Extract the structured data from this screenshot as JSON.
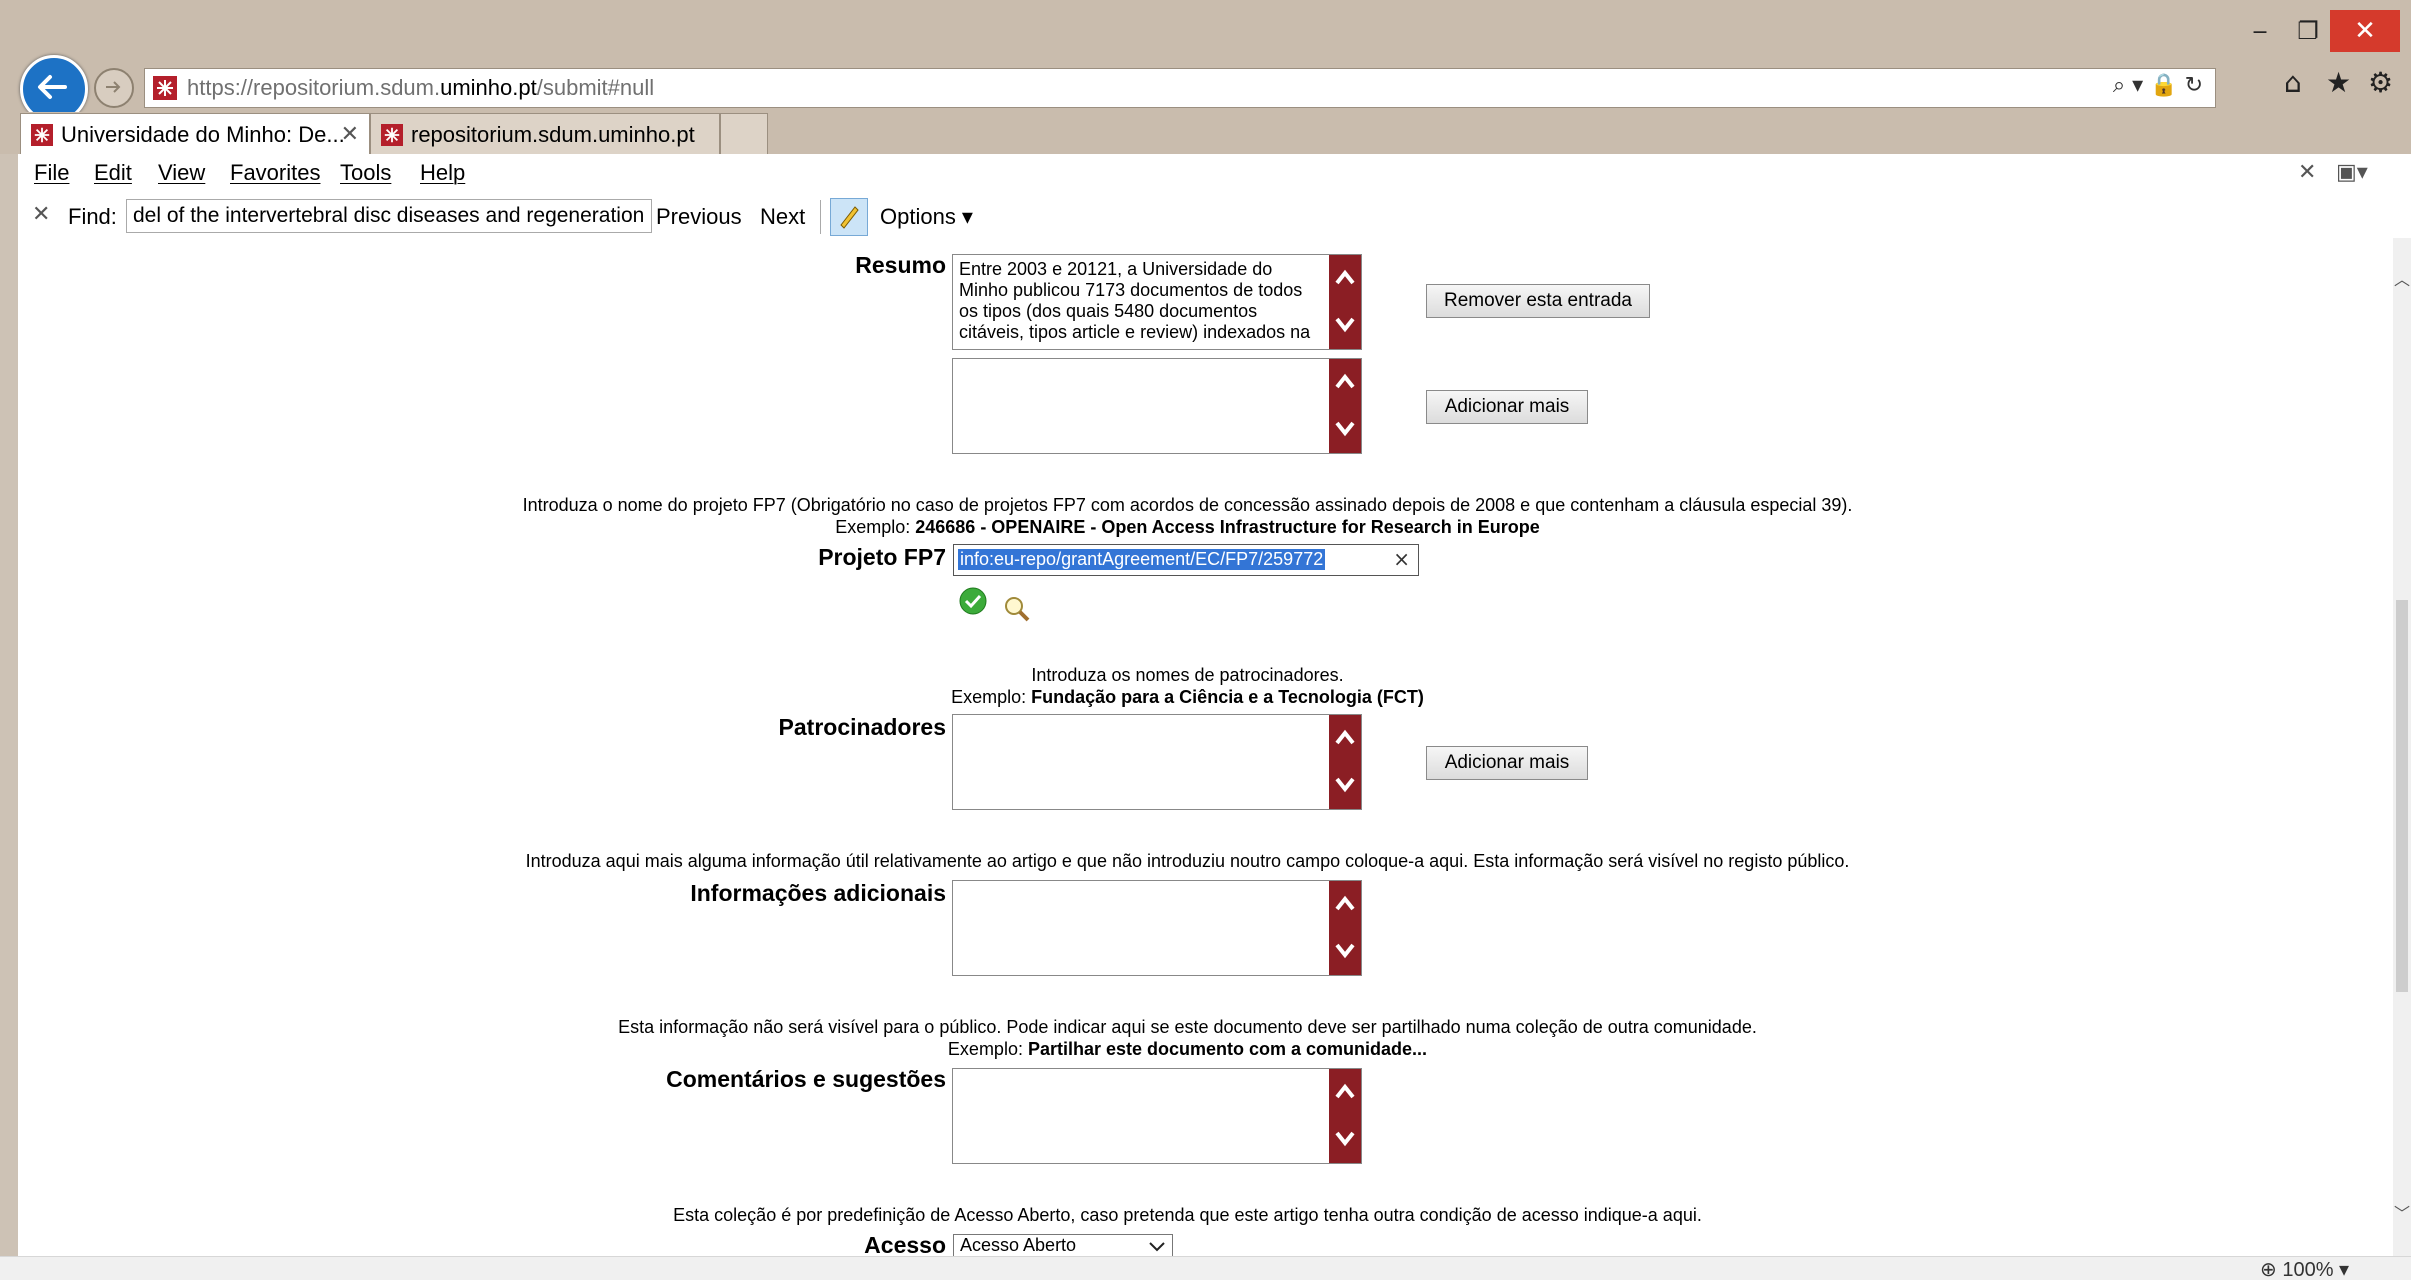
{
  "window": {
    "minimize": "‒",
    "maximize": "❐",
    "close": "✕"
  },
  "browser": {
    "url_prefix": "https://repositorium.sdum.",
    "url_domain": "uminho.pt",
    "url_path": "/submit#null",
    "address_icons": "⌕ ▾ 🔒 ↻",
    "home_icon": "⌂",
    "star_icon": "★",
    "gear_icon": "⚙",
    "tabs": [
      {
        "label": "Universidade do Minho: De...",
        "close": "✕"
      },
      {
        "label": "repositorium.sdum.uminho.pt"
      }
    ],
    "menu": [
      "File",
      "Edit",
      "View",
      "Favorites",
      "Tools",
      "Help"
    ],
    "menu_right_close": "✕",
    "find": {
      "close": "✕",
      "label": "Find:",
      "value": "del of the intervertebral disc diseases and regeneration",
      "previous": "Previous",
      "next": "Next",
      "options": "Options ▾"
    },
    "zoom": "100%"
  },
  "form": {
    "resumo": {
      "label": "Resumo",
      "value": "Entre 2003 e 20121, a Universidade do Minho publicou 7173 documentos de todos os tipos (dos quais 5480 documentos citáveis, tipos article e review) indexados na",
      "remove_button": "Remover esta entrada",
      "add_button": "Adicionar mais"
    },
    "fp7": {
      "help_line1": "Introduza o nome do projeto FP7 (Obrigatório no caso de projetos FP7 com acordos de concessão assinado depois de 2008 e que contenham a cláusula especial 39).",
      "example_prefix": "Exemplo: ",
      "example_bold": "246686 - OPENAIRE - Open Access Infrastructure for Research in Europe",
      "label": "Projeto FP7",
      "value": "info:eu-repo/grantAgreement/EC/FP7/259772",
      "clear": "×"
    },
    "patrocinadores": {
      "help_line1": "Introduza os nomes de patrocinadores.",
      "example_prefix": "Exemplo: ",
      "example_bold": "Fundação para a Ciência e a Tecnologia (FCT)",
      "label": "Patrocinadores",
      "add_button": "Adicionar mais"
    },
    "info_adicionais": {
      "help_line1": "Introduza aqui mais alguma informação útil relativamente ao artigo e que não introduziu noutro campo coloque-a aqui. Esta informação será visível no registo público.",
      "label": "Informações adicionais"
    },
    "comentarios": {
      "help_line1": "Esta informação não será visível para o público. Pode indicar aqui se este documento deve ser partilhado numa coleção de outra comunidade.",
      "example_prefix": "Exemplo: ",
      "example_bold": "Partilhar este documento com a comunidade...",
      "label": "Comentários e sugestões"
    },
    "acesso": {
      "help_line1": "Esta coleção é por predefinição de Acesso Aberto, caso pretenda que este artigo tenha outra condição de acesso indique-a aqui.",
      "label": "Acesso",
      "selected": "Acesso Aberto"
    }
  },
  "colors": {
    "accent": "#8b1e24",
    "brand": "#b41f2b",
    "selection": "#3375d6"
  }
}
